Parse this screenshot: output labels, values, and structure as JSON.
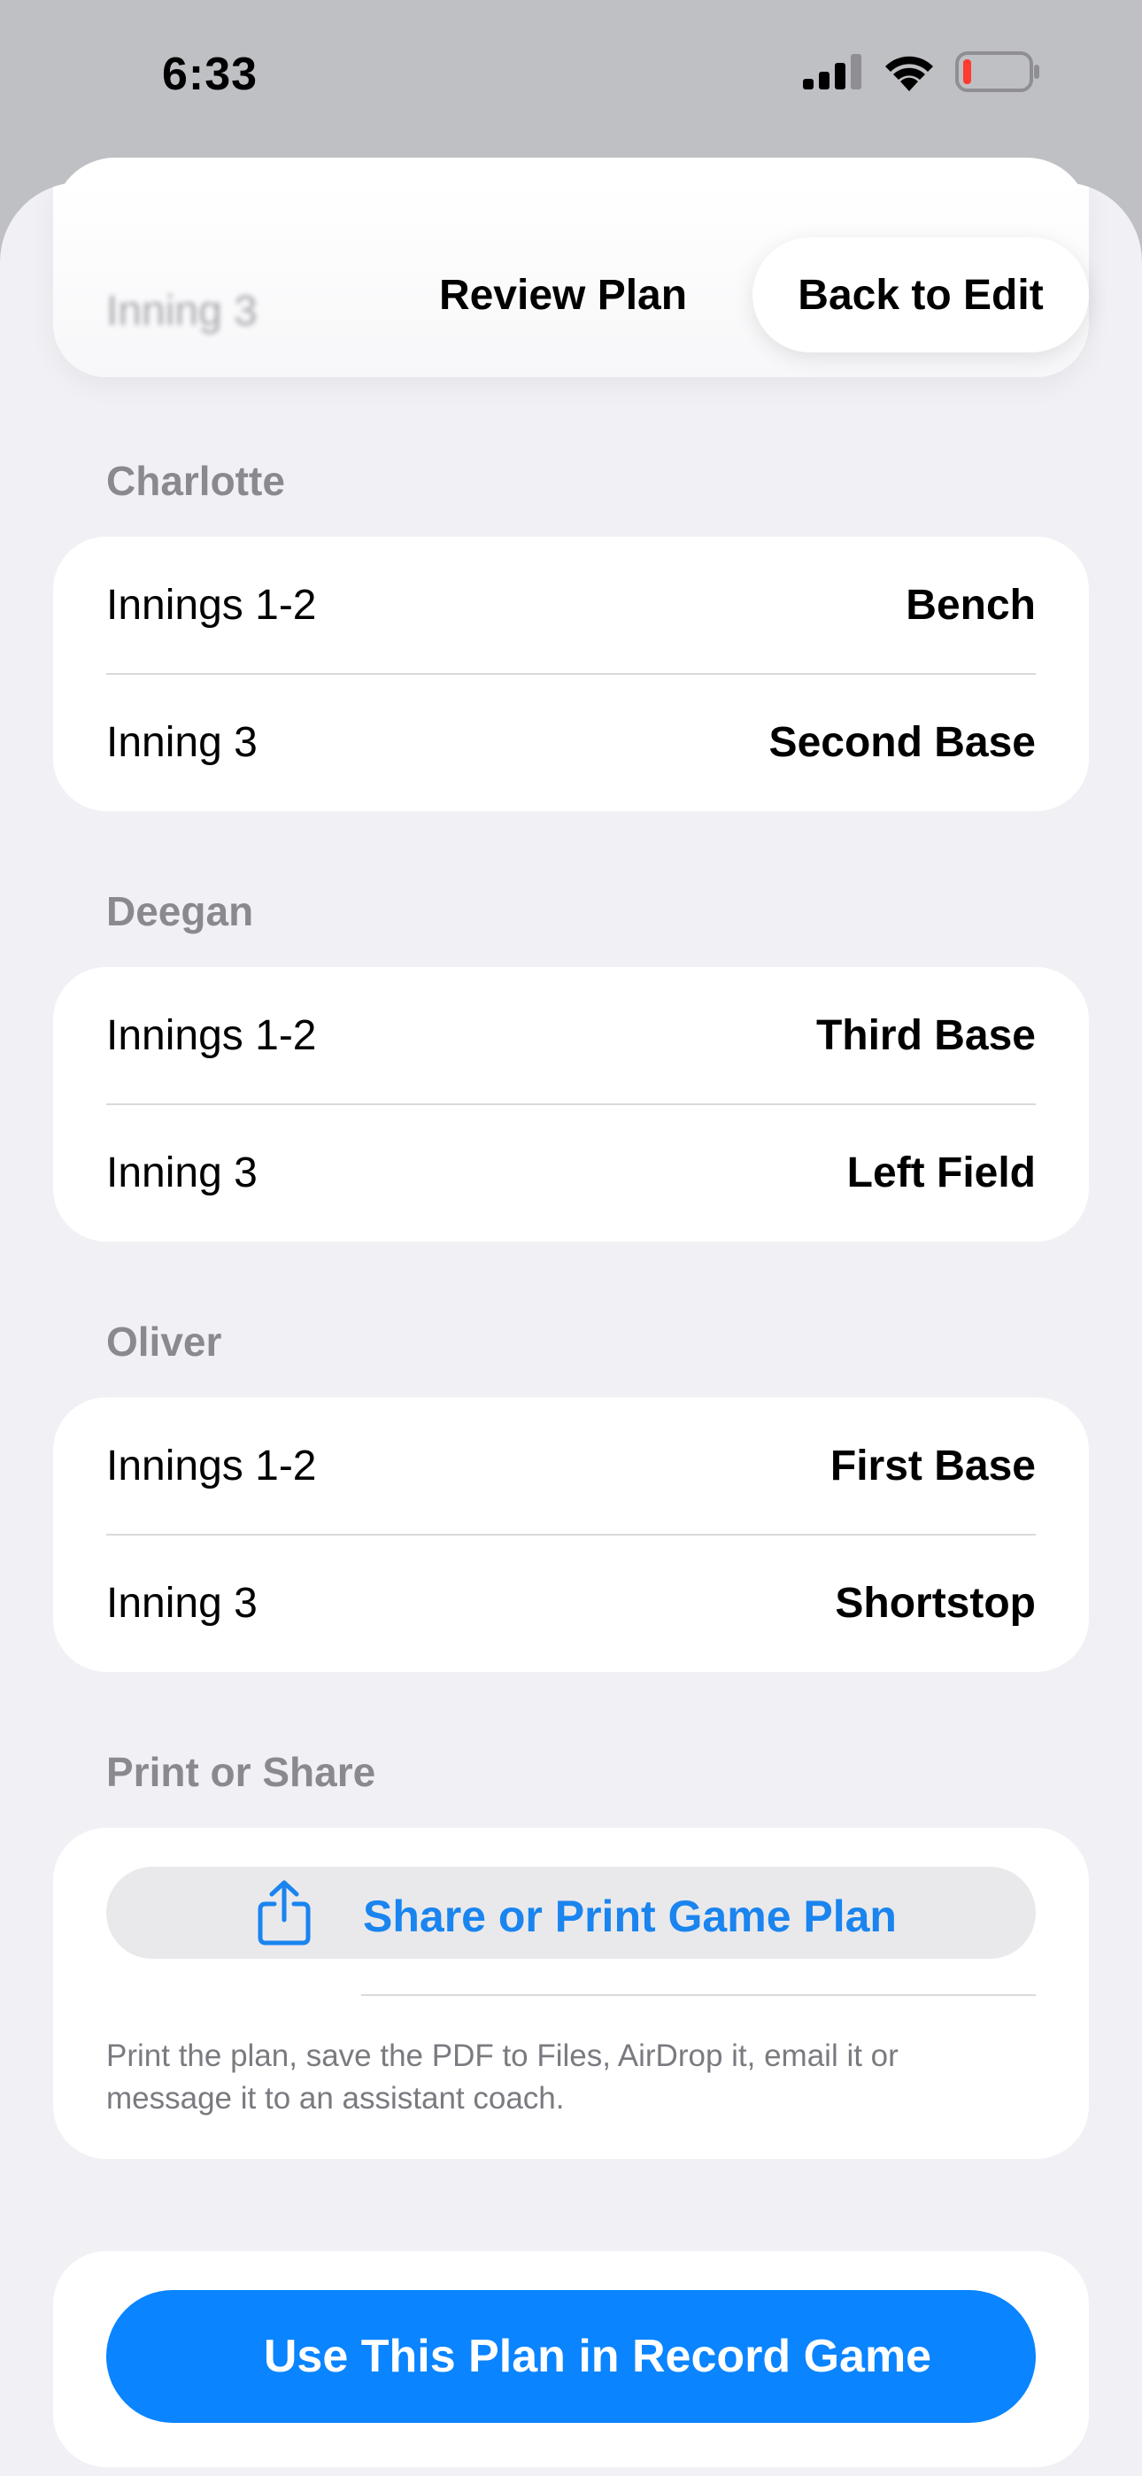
{
  "status_bar": {
    "time": "6:33",
    "icons": [
      "signal-icon",
      "wifi-icon",
      "battery-icon"
    ],
    "battery_color": "#ff3b30"
  },
  "background": {
    "ghost_row_label": "Inning 3"
  },
  "nav": {
    "title": "Review Plan",
    "back_label": "Back to Edit"
  },
  "players": [
    {
      "name": "Charlotte",
      "rows": [
        {
          "label": "Innings 1-2",
          "value": "Bench"
        },
        {
          "label": "Inning 3",
          "value": "Second Base"
        }
      ]
    },
    {
      "name": "Deegan",
      "rows": [
        {
          "label": "Innings 1-2",
          "value": "Third Base"
        },
        {
          "label": "Inning 3",
          "value": "Left Field"
        }
      ]
    },
    {
      "name": "Oliver",
      "rows": [
        {
          "label": "Innings 1-2",
          "value": "First Base"
        },
        {
          "label": "Inning 3",
          "value": "Shortstop"
        }
      ]
    }
  ],
  "share": {
    "header": "Print or Share",
    "button_label": "Share or Print Game Plan",
    "icon": "share-icon",
    "caption": "Print the plan, save the PDF to Files, AirDrop it, email it or message it to an assistant coach."
  },
  "record": {
    "button_label": "Use This Plan in Record Game"
  },
  "colors": {
    "accent": "#0a84ff",
    "link": "#1a84ef",
    "sheet_background": "#f1f1f5",
    "secondary_text": "#8a8a8e"
  }
}
